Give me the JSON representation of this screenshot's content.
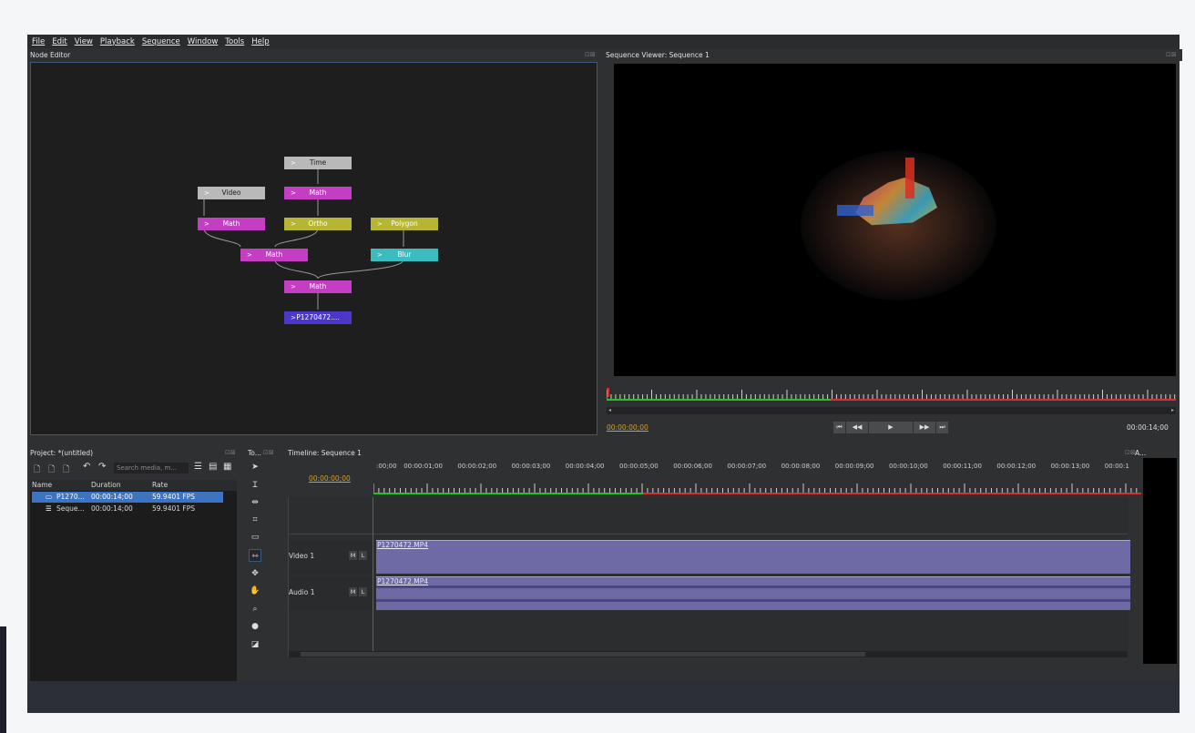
{
  "menu": [
    "File",
    "Edit",
    "View",
    "Playback",
    "Sequence",
    "Window",
    "Tools",
    "Help"
  ],
  "node_editor": {
    "title": "Node Editor",
    "nodes": {
      "time": "Time",
      "math1": "Math",
      "video": "Video",
      "math2": "Math",
      "ortho": "Ortho",
      "polygon": "Polygon",
      "math3": "Math",
      "blur": "Blur",
      "math4": "Math",
      "output": "P1270472...."
    },
    "arrow_glyph": ">"
  },
  "viewer": {
    "title": "Sequence Viewer: Sequence 1",
    "timecode_start": "00:00:00;00",
    "timecode_end": "00:00:14;00",
    "buttons": {
      "first": "⏮",
      "rewind": "◀◀",
      "play": "▶",
      "forward": "▶▶",
      "last": "⏭"
    }
  },
  "project": {
    "title": "Project: *(untitled)",
    "search_placeholder": "Search media, m...",
    "columns": [
      "Name",
      "Duration",
      "Rate"
    ],
    "rows": [
      {
        "name": "P1270...",
        "duration": "00:00:14;00",
        "rate": "59.9401 FPS"
      },
      {
        "name": "Seque...",
        "duration": "00:00:14;00",
        "rate": "59.9401 FPS"
      }
    ]
  },
  "tools": {
    "title": "To..."
  },
  "timeline": {
    "title": "Timeline: Sequence 1",
    "timecode": "00:00:00;00",
    "ruler_labels": [
      ":00;00",
      "00:00:01;00",
      "00:00:02;00",
      "00:00:03;00",
      "00:00:04;00",
      "00:00:05;00",
      "00:00:06;00",
      "00:00:07;00",
      "00:00:08;00",
      "00:00:09;00",
      "00:00:10;00",
      "00:00:11;00",
      "00:00:12;00",
      "00:00:13;00",
      "00:00:1"
    ],
    "tracks": [
      {
        "name": "Video 1",
        "m": "M",
        "l": "L",
        "clip": "P1270472.MP4"
      },
      {
        "name": "Audio 1",
        "m": "M",
        "l": "L",
        "clip": "P1270472.MP4"
      }
    ]
  },
  "audio_panel": {
    "title": "A..."
  },
  "colors": {
    "accent": "#3b5b7e",
    "selection": "#3c74c2",
    "timecode": "#d4a024",
    "progress_green": "#26c226",
    "progress_red": "#d83030"
  }
}
